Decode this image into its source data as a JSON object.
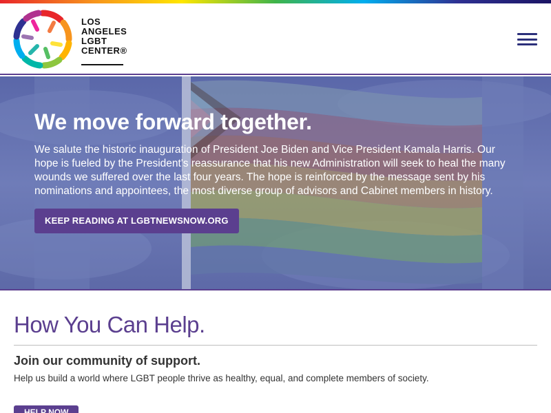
{
  "colors": {
    "brand_purple": "#5b3f8f",
    "menu_navy": "#2b2f7a",
    "hero_overlay": "#5866a8"
  },
  "header": {
    "logo": {
      "text_lines": [
        "LOS",
        "ANGELES",
        "LGBT",
        "CENTER®"
      ]
    },
    "menu_icon": "hamburger-menu-icon"
  },
  "hero": {
    "title": "We move forward together.",
    "body": "We salute the historic inauguration of President Joe Biden and Vice President Kamala Harris. Our hope is fueled by the President's reassurance that his new Administration will seek to heal the many wounds we suffered over the last four years. The hope is reinforced by the message sent by his nominations and appointees, the most diverse group of advisors and Cabinet members in history.",
    "button_label": "Keep reading at LGBTNEWSNOW.org"
  },
  "help": {
    "heading": "How You Can Help.",
    "subheading": "Join our community of support.",
    "text": "Help us build a world where LGBT people thrive as healthy, equal, and complete members of society.",
    "button_label": "Help Now"
  }
}
